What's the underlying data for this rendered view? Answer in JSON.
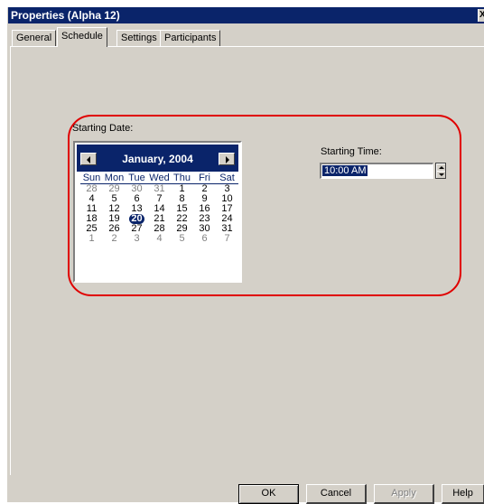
{
  "window": {
    "title": "Properties  (Alpha 12)",
    "close_glyph": "X"
  },
  "tabs": [
    {
      "label": "General",
      "active": false
    },
    {
      "label": "Schedule",
      "active": true
    },
    {
      "label": "Settings",
      "active": false
    },
    {
      "label": "Participants",
      "active": false
    }
  ],
  "schedule": {
    "date_label": "Starting Date:",
    "time_label": "Starting Time:",
    "time_value": "10:00 AM",
    "calendar": {
      "month": "January, 2004",
      "days_of_week": [
        "Sun",
        "Mon",
        "Tue",
        "Wed",
        "Thu",
        "Fri",
        "Sat"
      ],
      "weeks": [
        [
          [
            "28",
            "other"
          ],
          [
            "29",
            "other"
          ],
          [
            "30",
            "other"
          ],
          [
            "31",
            "other"
          ],
          [
            "1",
            ""
          ],
          [
            "2",
            ""
          ],
          [
            "3",
            ""
          ]
        ],
        [
          [
            "4",
            ""
          ],
          [
            "5",
            ""
          ],
          [
            "6",
            ""
          ],
          [
            "7",
            ""
          ],
          [
            "8",
            ""
          ],
          [
            "9",
            ""
          ],
          [
            "10",
            ""
          ]
        ],
        [
          [
            "11",
            ""
          ],
          [
            "12",
            ""
          ],
          [
            "13",
            ""
          ],
          [
            "14",
            ""
          ],
          [
            "15",
            ""
          ],
          [
            "16",
            ""
          ],
          [
            "17",
            ""
          ]
        ],
        [
          [
            "18",
            ""
          ],
          [
            "19",
            ""
          ],
          [
            "20",
            "selected"
          ],
          [
            "21",
            ""
          ],
          [
            "22",
            ""
          ],
          [
            "23",
            ""
          ],
          [
            "24",
            ""
          ]
        ],
        [
          [
            "25",
            ""
          ],
          [
            "26",
            ""
          ],
          [
            "27",
            ""
          ],
          [
            "28",
            ""
          ],
          [
            "29",
            ""
          ],
          [
            "30",
            ""
          ],
          [
            "31",
            ""
          ]
        ],
        [
          [
            "1",
            "other"
          ],
          [
            "2",
            "other"
          ],
          [
            "3",
            "other"
          ],
          [
            "4",
            "other"
          ],
          [
            "5",
            "other"
          ],
          [
            "6",
            "other"
          ],
          [
            "7",
            "other"
          ]
        ]
      ],
      "selected_day": "20"
    }
  },
  "buttons": {
    "ok": "OK",
    "cancel": "Cancel",
    "apply": "Apply",
    "help": "Help"
  },
  "colors": {
    "titlebar": "#0a246a",
    "face": "#d4d0c8",
    "highlight_outline": "#e00000"
  },
  "icons": {
    "prev_month": "triangle-left-icon",
    "next_month": "triangle-right-icon",
    "spin_up": "spin-up-icon",
    "spin_down": "spin-down-icon"
  }
}
